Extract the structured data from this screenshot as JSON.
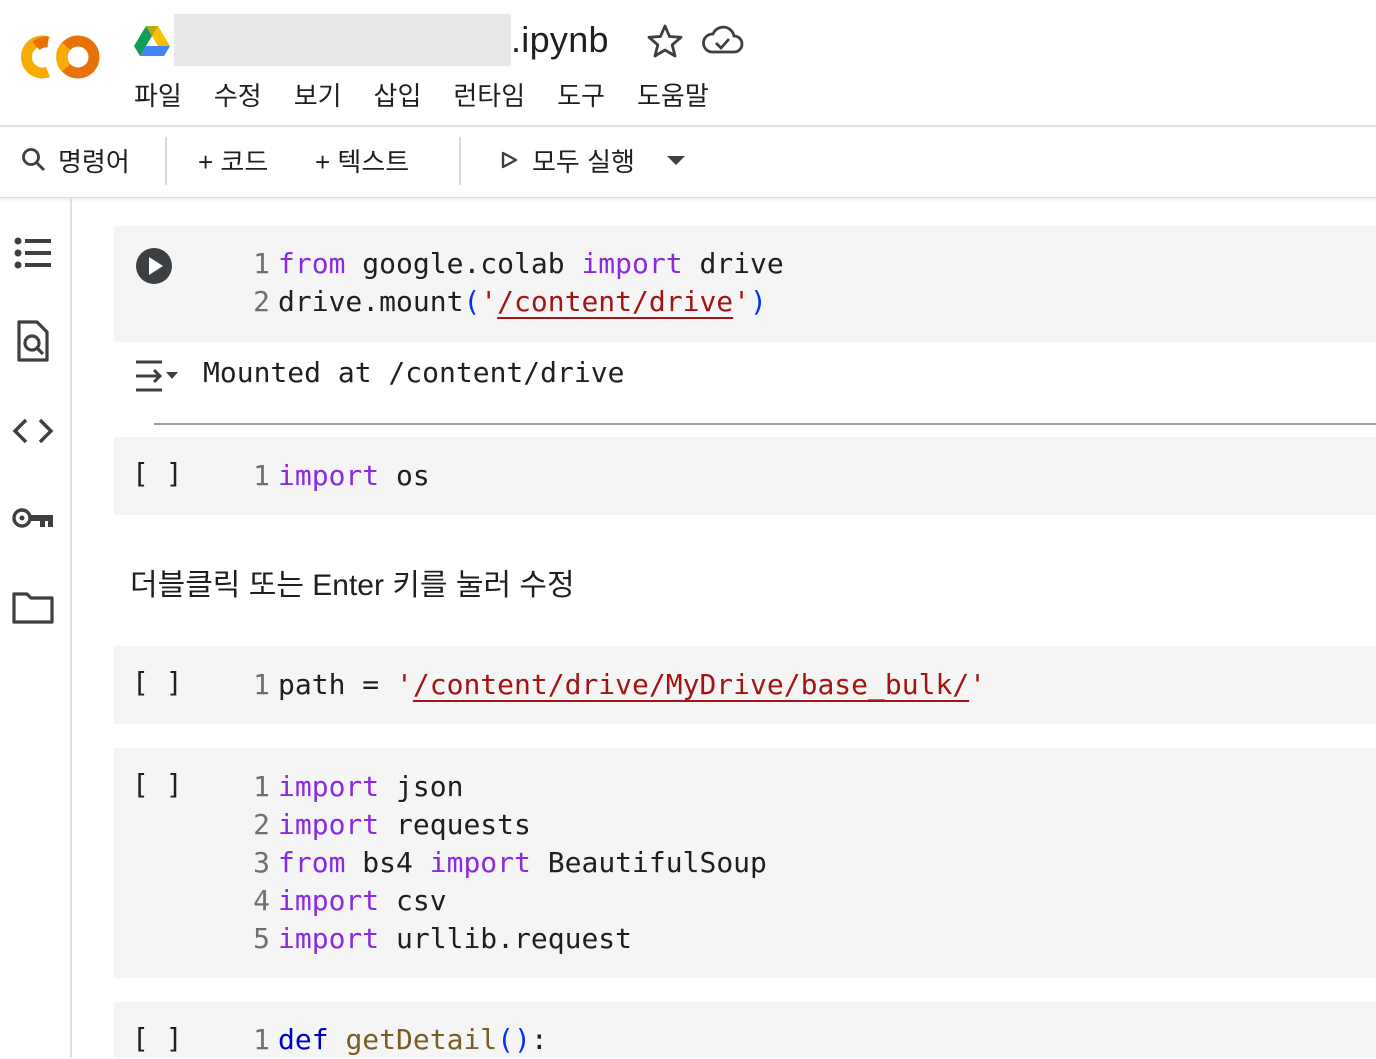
{
  "header": {
    "file_name_suffix": ".ipynb",
    "menu": [
      "파일",
      "수정",
      "보기",
      "삽입",
      "런타임",
      "도구",
      "도움말"
    ]
  },
  "toolbar": {
    "command_label": "명령어",
    "add_code_label": "+ 코드",
    "add_text_label": "+ 텍스트",
    "run_all_label": "모두 실행"
  },
  "sidebar": {
    "icons": [
      "table-of-contents-icon",
      "find-replace-icon",
      "code-snippets-icon",
      "secrets-key-icon",
      "files-folder-icon"
    ]
  },
  "cells": {
    "cell1": {
      "line1": {
        "n": "1",
        "kw1": "from",
        "mod": "google.colab",
        "kw2": "import",
        "name": "drive"
      },
      "line2": {
        "n": "2",
        "pre": "drive.mount",
        "open": "(",
        "q1": "'",
        "path": "/content/drive",
        "q2": "'",
        "close": ")"
      },
      "output": "Mounted at /content/drive"
    },
    "cell2": {
      "bracket": "[ ]",
      "n": "1",
      "kw": "import",
      "name": "os"
    },
    "text_cell": "더블클릭 또는 Enter 키를 눌러 수정",
    "cell3": {
      "bracket": "[ ]",
      "n": "1",
      "pre": "path = ",
      "q1": "'",
      "path": "/content/drive/MyDrive/base_bulk/",
      "q2": "'"
    },
    "cell4": {
      "bracket": "[ ]",
      "lines": [
        {
          "n": "1",
          "kw1": "import",
          "rest1": "json"
        },
        {
          "n": "2",
          "kw1": "import",
          "rest1": "requests"
        },
        {
          "n": "3",
          "kw1": "from",
          "mid": "bs4",
          "kw2": "import",
          "rest2": "BeautifulSoup"
        },
        {
          "n": "4",
          "kw1": "import",
          "rest1": "csv"
        },
        {
          "n": "5",
          "kw1": "import",
          "rest1": "urllib.request"
        }
      ]
    },
    "cell5": {
      "bracket": "[ ]",
      "n": "1",
      "kw": "def",
      "fn": "getDetail",
      "parens": "()",
      "colon": ":"
    }
  },
  "colors": {
    "keyword": "#8a2be2",
    "string": "#a31515",
    "paren": "#0431fa",
    "cell_bg": "#f5f5f5",
    "logo_orange": "#e8710a",
    "logo_yellow": "#f9ab00"
  }
}
